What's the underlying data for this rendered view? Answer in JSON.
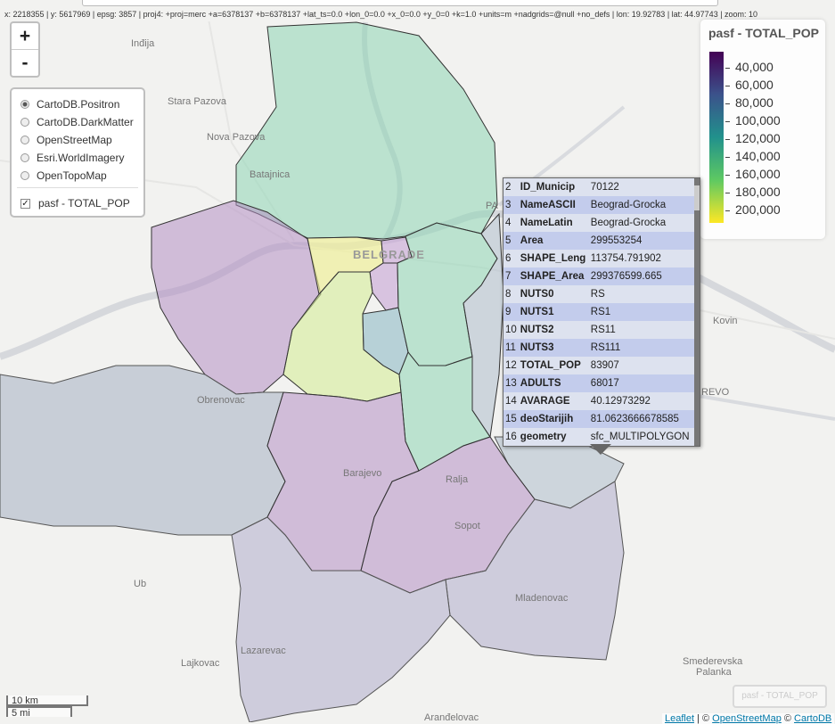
{
  "coords_text": "x: 2218355 | y: 5617969 | epsg: 3857 | proj4: +proj=merc +a=6378137 +b=6378137 +lat_ts=0.0 +lon_0=0.0 +x_0=0.0 +y_0=0 +k=1.0 +units=m +nadgrids=@null +no_defs | lon: 19.92783 | lat: 44.97743 | zoom: 10",
  "zoom": {
    "in_label": "+",
    "out_label": "-"
  },
  "layer_control": {
    "base_layers": [
      {
        "label": "CartoDB.Positron",
        "selected": true
      },
      {
        "label": "CartoDB.DarkMatter",
        "selected": false
      },
      {
        "label": "OpenStreetMap",
        "selected": false
      },
      {
        "label": "Esri.WorldImagery",
        "selected": false
      },
      {
        "label": "OpenTopoMap",
        "selected": false
      }
    ],
    "overlay": {
      "label": "pasf - TOTAL_POP",
      "checked": true
    }
  },
  "legend": {
    "title": "pasf - TOTAL_POP",
    "ticks": [
      "40,000",
      "60,000",
      "80,000",
      "100,000",
      "120,000",
      "140,000",
      "160,000",
      "180,000",
      "200,000"
    ],
    "colors": [
      "#440154",
      "#3b528b",
      "#21918c",
      "#5ec962",
      "#fde725"
    ]
  },
  "popup": {
    "rows": [
      {
        "n": "2",
        "key": "ID_Municip",
        "value": "70122"
      },
      {
        "n": "3",
        "key": "NameASCII",
        "value": "Beograd-Grocka"
      },
      {
        "n": "4",
        "key": "NameLatin",
        "value": "Beograd-Grocka"
      },
      {
        "n": "5",
        "key": "Area",
        "value": "299553254"
      },
      {
        "n": "6",
        "key": "SHAPE_Leng",
        "value": "113754.791902"
      },
      {
        "n": "7",
        "key": "SHAPE_Area",
        "value": "299376599.665"
      },
      {
        "n": "8",
        "key": "NUTS0",
        "value": "RS"
      },
      {
        "n": "9",
        "key": "NUTS1",
        "value": "RS1"
      },
      {
        "n": "10",
        "key": "NUTS2",
        "value": "RS11"
      },
      {
        "n": "11",
        "key": "NUTS3",
        "value": "RS111"
      },
      {
        "n": "12",
        "key": "TOTAL_POP",
        "value": "83907"
      },
      {
        "n": "13",
        "key": "ADULTS",
        "value": "68017"
      },
      {
        "n": "14",
        "key": "AVARAGE",
        "value": "40.12973292"
      },
      {
        "n": "15",
        "key": "deoStarijih",
        "value": "81.0623666678585"
      },
      {
        "n": "16",
        "key": "geometry",
        "value": "sfc_MULTIPOLYGON"
      }
    ]
  },
  "places": {
    "indija": "Inđija",
    "stara_pazova": "Stara Pazova",
    "nova_pazova": "Nova Pazova",
    "batajnica": "Batajnica",
    "belgrade": "BELGRADE",
    "kovin": "Kovin",
    "obrenovac": "Obrenovac",
    "barajevo": "Barajevo",
    "ralja": "Ralja",
    "sopot": "Sopot",
    "ub": "Ub",
    "mladenovac": "Mladenovac",
    "lajkovac": "Lajkovac",
    "lazarevac": "Lazarevac",
    "smederevska_palanka": "Smederevska Palanka",
    "arandjelovac": "Aranđelovac",
    "pancevo_fragment": "PA",
    "smederevo_fragment": "REVO"
  },
  "scale": {
    "km": "10 km",
    "mi": "5 mi"
  },
  "attribution": {
    "leaflet": "Leaflet",
    "separator": " | © ",
    "osm": "OpenStreetMap",
    "sep2": " © ",
    "carto": "CartoDB"
  },
  "watermark": "pasf - TOTAL_POP"
}
